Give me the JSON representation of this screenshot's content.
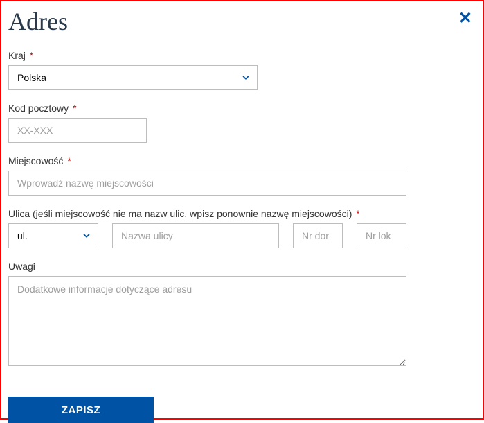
{
  "title": "Adres",
  "required_mark": "*",
  "fields": {
    "country": {
      "label": "Kraj",
      "value": "Polska"
    },
    "postal": {
      "label": "Kod pocztowy",
      "placeholder": "XX-XXX"
    },
    "city": {
      "label": "Miejscowość",
      "placeholder": "Wprowadź nazwę miejscowości"
    },
    "street": {
      "label": "Ulica (jeśli miejscowość nie ma nazw ulic, wpisz ponownie nazwę miejscowości)",
      "prefix": "ul.",
      "name_placeholder": "Nazwa ulicy",
      "nr_dom_placeholder": "Nr dor",
      "nr_lok_placeholder": "Nr lok"
    },
    "notes": {
      "label": "Uwagi",
      "placeholder": "Dodatkowe informacje dotyczące adresu"
    }
  },
  "submit_label": "ZAPISZ"
}
